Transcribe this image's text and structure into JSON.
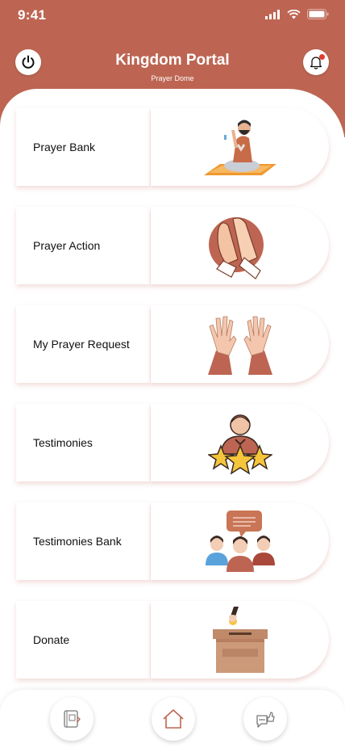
{
  "status_bar": {
    "time": "9:41"
  },
  "header": {
    "title": "Kingdom Portal",
    "subtitle": "Prayer Dome"
  },
  "menu": [
    {
      "label": "Prayer Bank",
      "icon": "praying-man-icon"
    },
    {
      "label": "Prayer Action",
      "icon": "praying-hands-icon"
    },
    {
      "label": "My Prayer Request",
      "icon": "raised-hands-icon"
    },
    {
      "label": "Testimonies",
      "icon": "person-stars-icon"
    },
    {
      "label": "Testimonies Bank",
      "icon": "group-chat-icon"
    },
    {
      "label": "Donate",
      "icon": "donation-box-icon"
    }
  ],
  "bottom_nav": [
    {
      "icon": "bible-icon"
    },
    {
      "icon": "home-icon"
    },
    {
      "icon": "chat-thumbs-up-icon"
    }
  ],
  "colors": {
    "accent": "#bd6552",
    "notification": "#e23b2e"
  }
}
